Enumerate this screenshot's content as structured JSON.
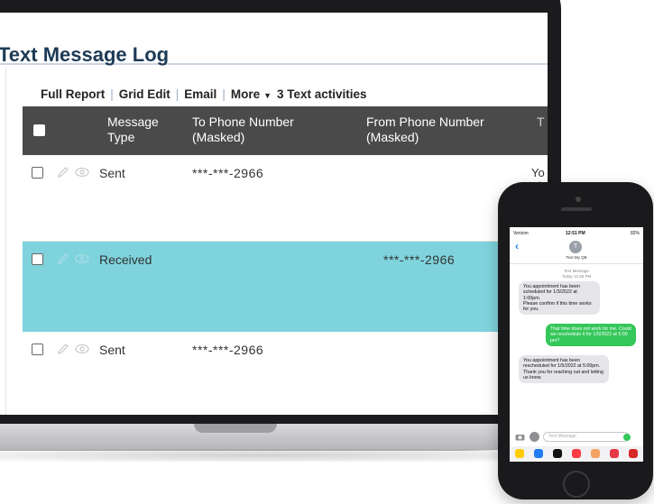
{
  "app": {
    "title": "Text Message Log"
  },
  "toolbar": {
    "full_report": "Full Report",
    "grid_edit": "Grid Edit",
    "email": "Email",
    "more": "More",
    "activity_count": "3 Text activities",
    "separator": "|"
  },
  "table": {
    "columns": {
      "message_type": "Message Type",
      "to_phone": "To Phone Number (Masked)",
      "from_phone": "From Phone Number (Masked)",
      "extra": "T"
    },
    "rows": [
      {
        "type": "Sent",
        "to": "***-***-2966",
        "from": "",
        "extra": "Yo\nTh",
        "highlighted": false
      },
      {
        "type": "Received",
        "to": "",
        "from": "***-***-2966",
        "extra": "",
        "highlighted": true
      },
      {
        "type": "Sent",
        "to": "***-***-2966",
        "from": "",
        "extra": "",
        "highlighted": false
      }
    ],
    "highlight_color": "#7fd3dd",
    "header_color": "#4a4a4a"
  },
  "phone": {
    "status": {
      "carrier": "Verizon",
      "time": "12:51 PM",
      "battery": "82%"
    },
    "contact": {
      "initial": "T",
      "name": "Text My QB"
    },
    "timestamp": {
      "label": "Text Message",
      "time": "Today 12:46 PM"
    },
    "messages": [
      {
        "direction": "incoming",
        "text": "You appointment has been scheduled for 1/3/2022 at 1:00pm.\nPlease confirm if this time works for you."
      },
      {
        "direction": "outgoing",
        "text": "That time does not work for me. Could we reschedule it for 1/5/2022 at 5:00 pm?"
      },
      {
        "direction": "incoming",
        "text": "You appointment has been rescheduled for 1/5/2022 at 5:00pm.\nThank you for reaching out and letting us know."
      }
    ],
    "input_placeholder": "Text Message",
    "colors": {
      "incoming": "#e5e5ea",
      "outgoing": "#34c759",
      "link": "#1f7cf2"
    }
  }
}
